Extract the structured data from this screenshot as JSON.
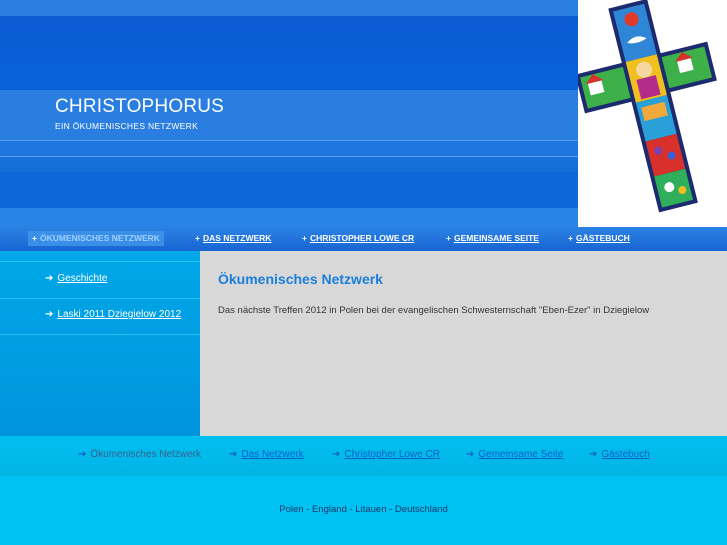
{
  "header": {
    "title": "CHRISTOPHORUS",
    "subtitle": "EIN ÖKUMENISCHES NETZWERK",
    "logo_icon": "cross-logo-icon"
  },
  "topnav": {
    "items": [
      {
        "label": "ÖKUMENISCHES NETZWERK",
        "active": true
      },
      {
        "label": "DAS NETZWERK",
        "active": false
      },
      {
        "label": "CHRISTOPHER LOWE CR",
        "active": false
      },
      {
        "label": "GEMEINSAME SEITE",
        "active": false
      },
      {
        "label": "GÄSTEBUCH",
        "active": false
      }
    ],
    "bullet": "+"
  },
  "sidebar": {
    "items": [
      {
        "label": "Geschichte"
      },
      {
        "label": "Laski 2011 Dziegielow 2012"
      }
    ],
    "arrow": "➔"
  },
  "main": {
    "title": "Ökumenisches Netzwerk",
    "text": "Das nächste Treffen 2012 in Polen bei der evangelischen Schwesternschaft \"Eben-Ezer\" in Dziegielow"
  },
  "bottomnav": {
    "items": [
      {
        "label": "Ökumenisches Netzwerk",
        "current": true
      },
      {
        "label": "Das Netzwerk",
        "current": false
      },
      {
        "label": "Christopher Lowe CR",
        "current": false
      },
      {
        "label": "Gemeinsame Seite",
        "current": false
      },
      {
        "label": "Gästebuch",
        "current": false
      }
    ],
    "arrow": "➔"
  },
  "footer": {
    "text": "Polen - England - Litauen - Deutschland"
  },
  "colors": {
    "header_blue": "#0a62d8",
    "nav_blue": "#1864d3",
    "sidebar_blue": "#00a8e8",
    "content_gray": "#d8d8d8",
    "title_blue": "#1a7fdc",
    "footer_cyan": "#00c2f2"
  }
}
